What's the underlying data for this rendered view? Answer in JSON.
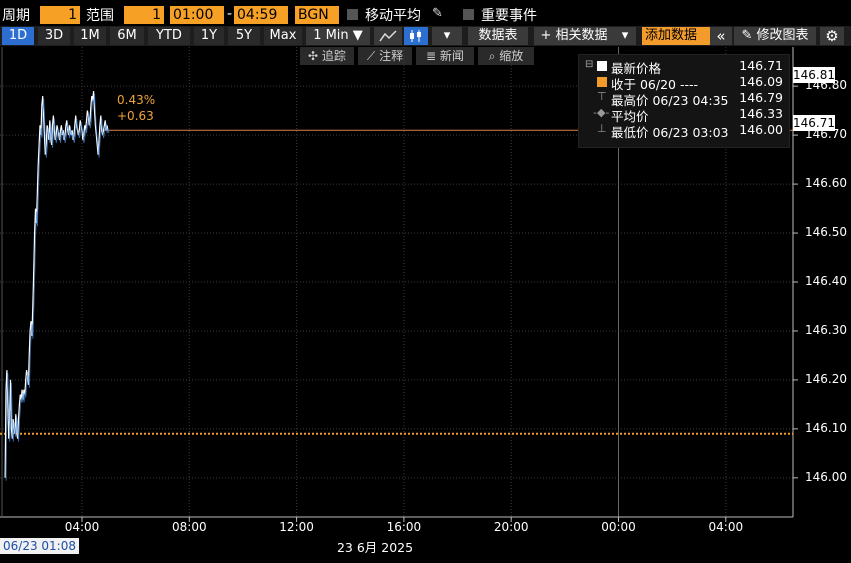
{
  "toolbar": {
    "period_label": "周期",
    "period_value": "1",
    "range_label": "范围",
    "range_value": "1",
    "time_start": "01:00",
    "time_sep": "-",
    "time_end": "04:59",
    "source": "BGN",
    "moving_avg_label": "移动平均",
    "key_events_label": "重要事件"
  },
  "rangebar": {
    "ranges": [
      "1D",
      "3D",
      "1M",
      "6M",
      "YTD",
      "1Y",
      "5Y",
      "Max"
    ],
    "selected": "1D",
    "interval": "1 Min ▼",
    "datatable_label": "数据表",
    "related_label": "+ 相关数据",
    "related_caret": "▾",
    "add_data_label": "添加数据",
    "prev_label": "«",
    "edit_chart_label": "修改图表",
    "caret": "▾"
  },
  "tools": {
    "track": "追踪",
    "annotate": "注释",
    "news": "新闻",
    "zoom": "缩放"
  },
  "legend": {
    "rows": [
      {
        "name": "最新价格",
        "value": "146.71",
        "color": "#ffffff"
      },
      {
        "name": "收于 06/20 ----",
        "value": "146.09",
        "color": "#f39c2b"
      },
      {
        "name": "最高价 06/23 04:35",
        "value": "146.79",
        "color": "#aaaaaa"
      },
      {
        "name": "平均价",
        "value": "146.33",
        "color": "#aaaaaa"
      },
      {
        "name": "最低价 06/23 03:03",
        "value": "146.00",
        "color": "#aaaaaa"
      }
    ]
  },
  "annotation": {
    "pct": "0.43%",
    "chg": "+0.63"
  },
  "tags": {
    "high": "146.81",
    "last": "146.71"
  },
  "footer": {
    "date_box": "06/23 01:08",
    "caption": "23 6月 2025"
  },
  "colors": {
    "accent": "#f39c2b",
    "line": "#ffffff",
    "prev_close": "#f39c2b",
    "selected": "#2d6fd1"
  },
  "chart_data": {
    "type": "line",
    "title": "",
    "xlabel": "",
    "ylabel": "",
    "ylim": [
      145.92,
      146.88
    ],
    "y_ticks": [
      "146.00",
      "146.10",
      "146.20",
      "146.30",
      "146.40",
      "146.50",
      "146.60",
      "146.70",
      "146.80"
    ],
    "x_ticks": [
      "04:00",
      "08:00",
      "12:00",
      "16:00",
      "20:00",
      "00:00",
      "04:00"
    ],
    "prev_close": 146.09,
    "last": 146.71,
    "series": [
      {
        "x": [
          "01:08",
          "01:10",
          "01:12",
          "01:14",
          "01:16",
          "01:18",
          "01:20",
          "01:22",
          "01:24",
          "01:26",
          "01:28",
          "01:30",
          "01:32",
          "01:34",
          "01:36",
          "01:38",
          "01:40",
          "01:42",
          "01:44",
          "01:46",
          "01:48",
          "01:50",
          "01:52",
          "01:54",
          "01:56",
          "01:58",
          "02:00",
          "02:02",
          "02:04",
          "02:06",
          "02:08",
          "02:10",
          "02:12",
          "02:14",
          "02:16",
          "02:18",
          "02:20",
          "02:22",
          "02:24",
          "02:26",
          "02:28",
          "02:30",
          "02:32",
          "02:34",
          "02:36",
          "02:38",
          "02:40",
          "02:42",
          "02:44",
          "02:46",
          "02:48",
          "02:50",
          "02:52",
          "02:54",
          "02:56",
          "02:58",
          "03:00",
          "03:02",
          "03:04",
          "03:06",
          "03:08",
          "03:10",
          "03:12",
          "03:14",
          "03:16",
          "03:18",
          "03:20",
          "03:22",
          "03:24",
          "03:26",
          "03:28",
          "03:30",
          "03:32",
          "03:34",
          "03:36",
          "03:38",
          "03:40",
          "03:42",
          "03:44",
          "03:46",
          "03:48",
          "03:50",
          "03:52",
          "03:54",
          "03:56",
          "03:58",
          "04:00",
          "04:02",
          "04:04",
          "04:06",
          "04:08",
          "04:10",
          "04:12",
          "04:14",
          "04:16",
          "04:18",
          "04:20",
          "04:22",
          "04:24",
          "04:26",
          "04:28",
          "04:30",
          "04:32",
          "04:34",
          "04:36",
          "04:38",
          "04:40",
          "04:42",
          "04:44",
          "04:46",
          "04:48",
          "04:50",
          "04:52",
          "04:54",
          "04:56",
          "04:58"
        ],
        "values": [
          146.0,
          146.18,
          146.22,
          146.15,
          146.08,
          146.12,
          146.2,
          146.1,
          146.08,
          146.12,
          146.1,
          146.09,
          146.13,
          146.1,
          146.08,
          146.12,
          146.15,
          146.17,
          146.16,
          146.18,
          146.16,
          146.18,
          146.17,
          146.2,
          146.22,
          146.21,
          146.19,
          146.25,
          146.3,
          146.32,
          146.29,
          146.35,
          146.42,
          146.5,
          146.55,
          146.52,
          146.58,
          146.64,
          146.68,
          146.72,
          146.7,
          146.76,
          146.78,
          146.74,
          146.7,
          146.66,
          146.68,
          146.72,
          146.71,
          146.69,
          146.73,
          146.7,
          146.68,
          146.72,
          146.74,
          146.71,
          146.69,
          146.7,
          146.72,
          146.71,
          146.7,
          146.69,
          146.71,
          146.72,
          146.7,
          146.71,
          146.69,
          146.7,
          146.72,
          146.73,
          146.71,
          146.7,
          146.72,
          146.71,
          146.7,
          146.71,
          146.69,
          146.7,
          146.72,
          146.74,
          146.72,
          146.71,
          146.7,
          146.71,
          146.73,
          146.72,
          146.71,
          146.69,
          146.7,
          146.72,
          146.71,
          146.73,
          146.75,
          146.74,
          146.72,
          146.73,
          146.76,
          146.78,
          146.77,
          146.79,
          146.75,
          146.72,
          146.7,
          146.68,
          146.66,
          146.69,
          146.72,
          146.74,
          146.71,
          146.7,
          146.71,
          146.72,
          146.73,
          146.71,
          146.72,
          146.71
        ]
      }
    ]
  }
}
